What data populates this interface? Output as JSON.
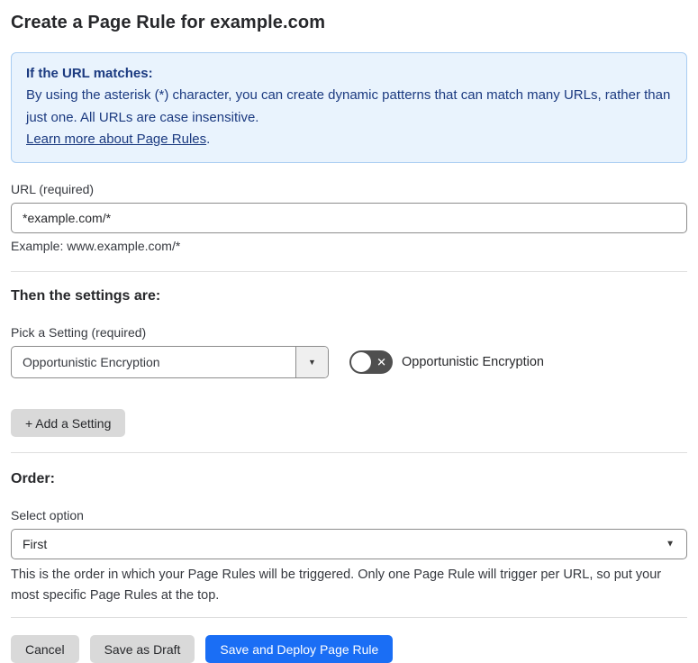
{
  "page": {
    "title": "Create a Page Rule for example.com"
  },
  "info_box": {
    "heading": "If the URL matches:",
    "body": "By using the asterisk (*) character, you can create dynamic patterns that can match many URLs, rather than just one. All URLs are case insensitive.",
    "link_label": "Learn more about Page Rules",
    "link_suffix": "."
  },
  "url_field": {
    "label": "URL (required)",
    "value": "*example.com/*",
    "example": "Example: www.example.com/*"
  },
  "settings_section": {
    "heading": "Then the settings are:",
    "pick_label": "Pick a Setting (required)",
    "selected_setting": "Opportunistic Encryption",
    "toggle_label": "Opportunistic Encryption",
    "toggle_state": "off",
    "add_button_label": "+ Add a Setting"
  },
  "order_section": {
    "heading": "Order:",
    "select_label": "Select option",
    "selected_option": "First",
    "help_text": "This is the order in which your Page Rules will be triggered. Only one Page Rule will trigger per URL, so put your most specific Page Rules at the top."
  },
  "footer": {
    "cancel_label": "Cancel",
    "save_draft_label": "Save as Draft",
    "save_deploy_label": "Save and Deploy Page Rule"
  },
  "icons": {
    "dropdown_caret": "▼",
    "toggle_off_x": "✕"
  },
  "colors": {
    "info_bg": "#e9f3fd",
    "info_border": "#a9cdf2",
    "info_text": "#1b3a80",
    "primary_button": "#1a6ef5",
    "gray_button": "#d9d9d9",
    "toggle_off": "#4f4f4f",
    "divider": "#dedede"
  }
}
